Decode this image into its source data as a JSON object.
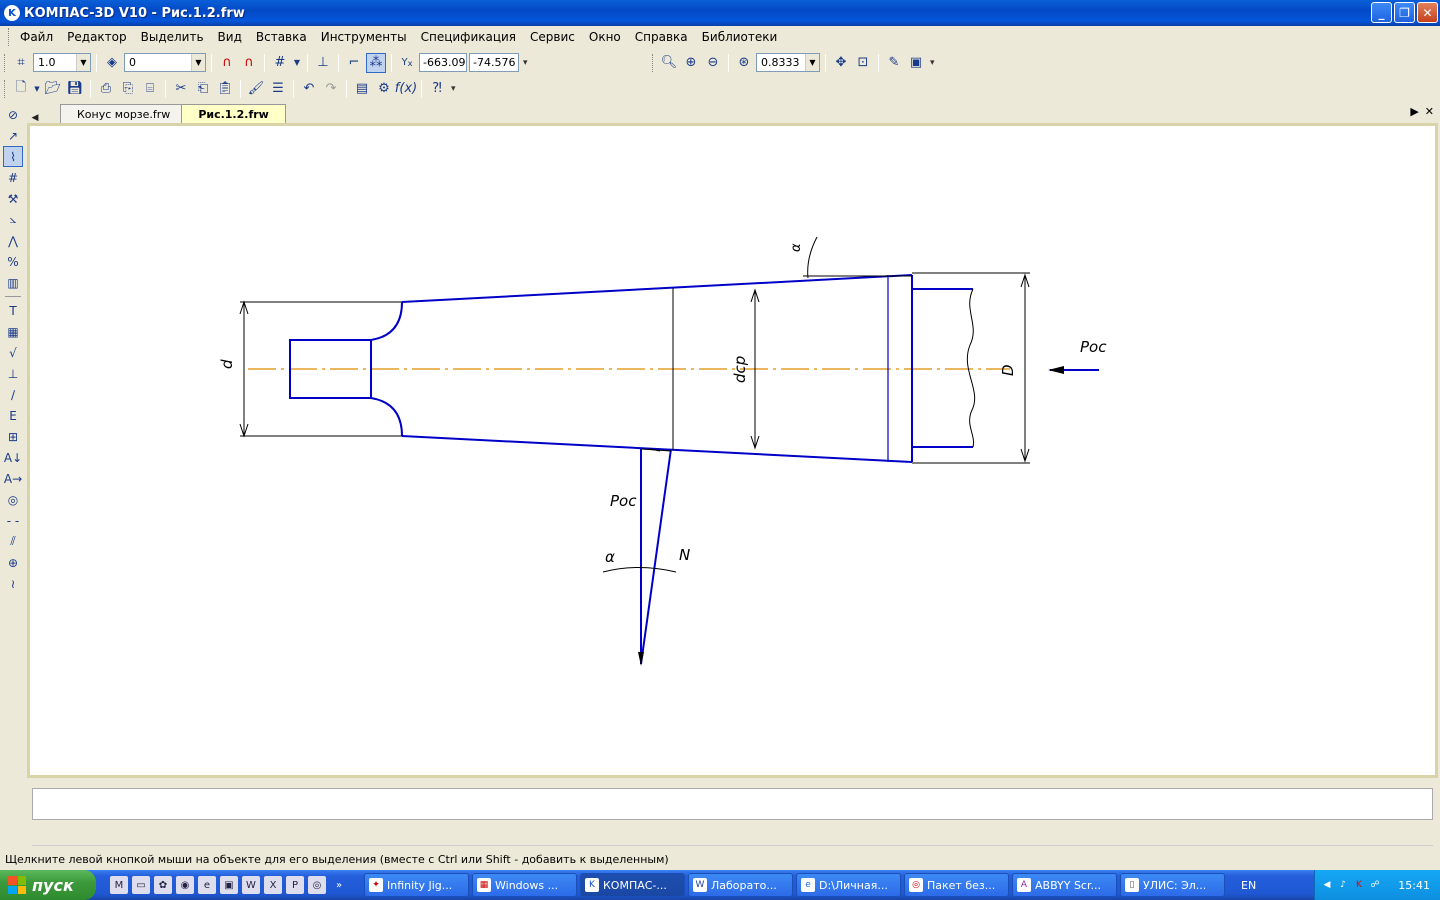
{
  "window": {
    "title": "КОМПАС-3D V10 - Рис.1.2.frw",
    "app_icon": "K"
  },
  "menu": [
    "Файл",
    "Редактор",
    "Выделить",
    "Вид",
    "Вставка",
    "Инструменты",
    "Спецификация",
    "Сервис",
    "Окно",
    "Справка",
    "Библиотеки"
  ],
  "toolbar": {
    "step_value": "1.0",
    "layer_value": "0",
    "coord_x": "-663.09",
    "coord_y": "-74.576",
    "zoom_value": "0.8333"
  },
  "tabs": [
    {
      "label": "Конус морзе.frw",
      "active": false
    },
    {
      "label": "Рис.1.2.frw",
      "active": true
    }
  ],
  "drawing": {
    "label_d": "d",
    "label_dcp": "dср",
    "label_D": "D",
    "label_p_right": "Pос",
    "label_p_bottom": "Pос",
    "label_alpha_top": "α",
    "label_alpha_bottom": "α",
    "label_N": "N",
    "colors": {
      "contour": "#0000c8",
      "axis": "#e08a00",
      "dim": "#000000"
    }
  },
  "status": {
    "hint": "Щелкните левой кнопкой мыши на объекте для его выделения (вместе с Ctrl или Shift - добавить к выделенным)"
  },
  "taskbar": {
    "start_label": "пуск",
    "items": [
      {
        "label": "Infinity Jig...",
        "icon": "jigsaw-icon"
      },
      {
        "label": "Windows ...",
        "icon": "windows-icon"
      },
      {
        "label": "КОМПАС-...",
        "icon": "kompas-icon",
        "active": true
      },
      {
        "label": "Лаборато...",
        "icon": "word-icon"
      },
      {
        "label": "D:\\Личная...",
        "icon": "ie-icon"
      },
      {
        "label": "Пакет без...",
        "icon": "package-icon"
      },
      {
        "label": "ABBYY Scr...",
        "icon": "abbyy-icon"
      },
      {
        "label": "УЛИС: Эл...",
        "icon": "book-icon"
      }
    ],
    "lang": "EN",
    "clock": "15:41"
  }
}
